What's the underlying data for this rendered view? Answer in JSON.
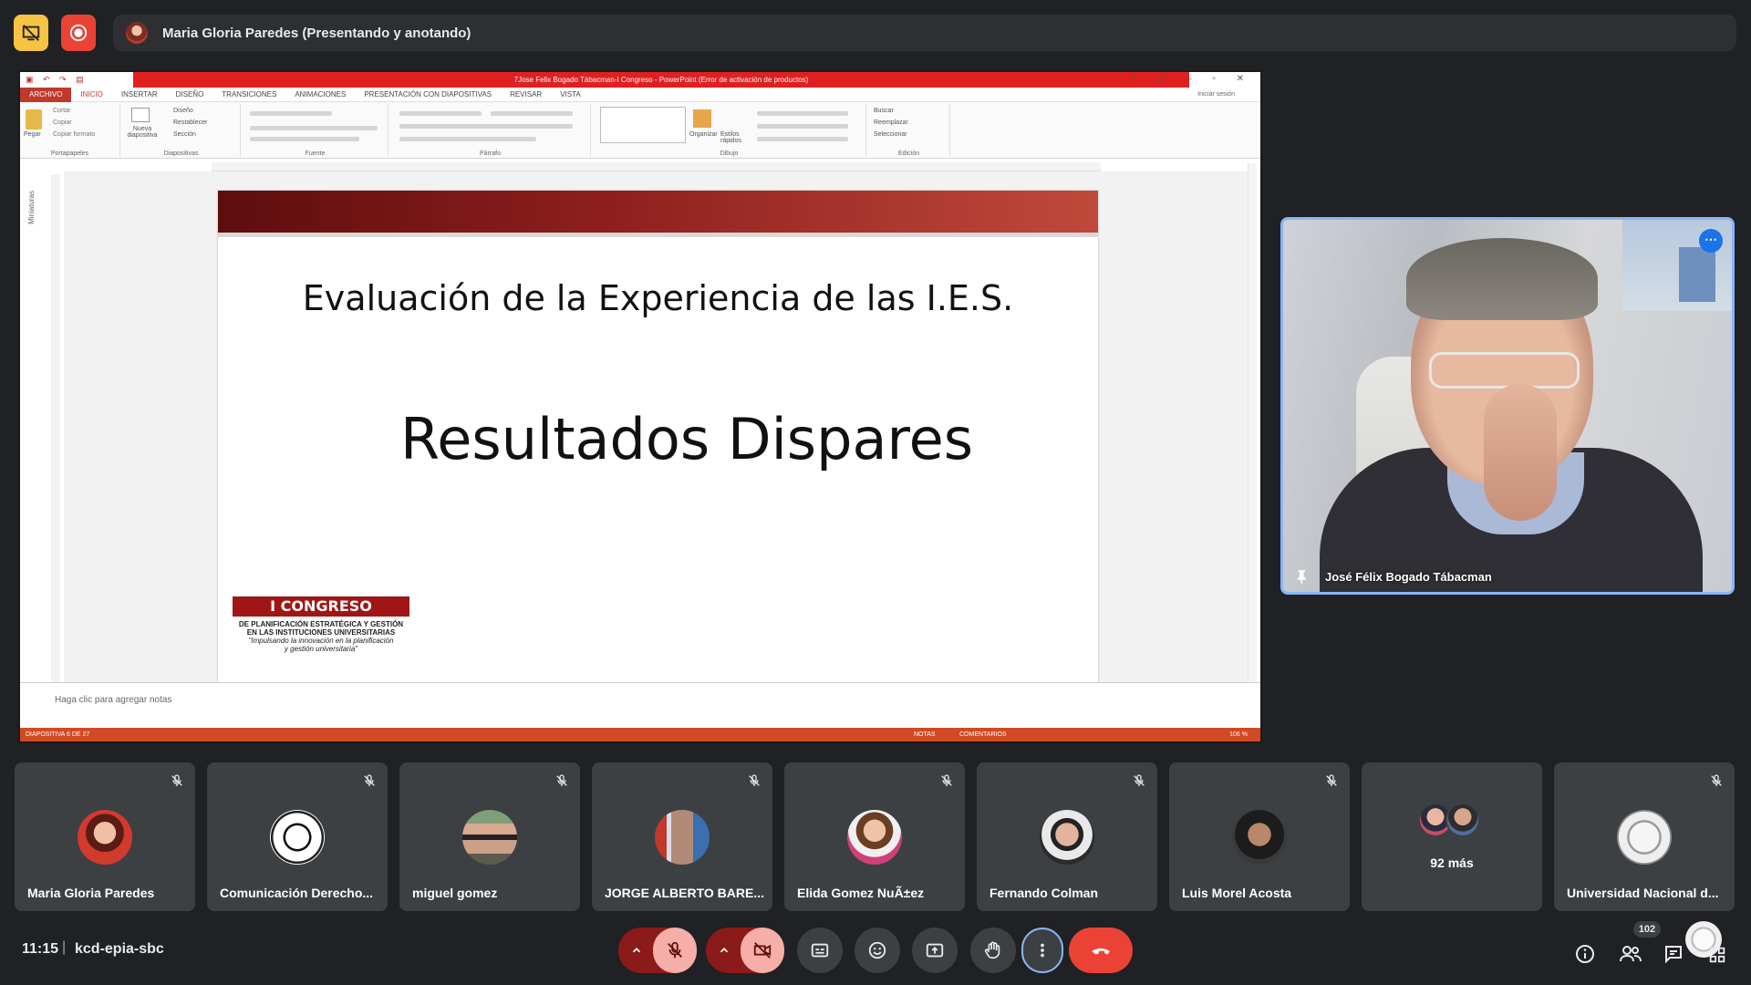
{
  "top_bar": {
    "presenter_label": "Maria Gloria Paredes (Presentando y anotando)"
  },
  "powerpoint": {
    "title": "7Jose Felix Bogado Tábacman-I Congreso - PowerPoint (Error de activación de productos)",
    "tabs": [
      "ARCHIVO",
      "INICIO",
      "INSERTAR",
      "DISEÑO",
      "TRANSICIONES",
      "ANIMACIONES",
      "PRESENTACIÓN CON DIAPOSITIVAS",
      "REVISAR",
      "VISTA"
    ],
    "active_tab": "INICIO",
    "sign_in": "Iniciar sesión",
    "ribbon_groups": [
      "Portapapeles",
      "Diapositivas",
      "Fuente",
      "Párrafo",
      "Dibujo",
      "Edición"
    ],
    "ribbon_items": {
      "paste": "Pegar",
      "cut": "Cortar",
      "copy": "Copiar",
      "format_painter": "Copiar formato",
      "new_slide": "Nueva diapositiva",
      "layout": "Diseño",
      "reset": "Restablecer",
      "section": "Sección",
      "arrange": "Organizar",
      "quick_styles": "Estilos rápidos",
      "find": "Buscar",
      "replace": "Reemplazar",
      "select": "Seleccionar"
    },
    "thumbnails_label": "Miniaturas",
    "notes_placeholder": "Haga clic para agregar notas",
    "status": {
      "slide": "DIAPOSITIVA 6 DE 27",
      "notes": "NOTAS",
      "comments": "COMENTARIOS",
      "zoom": "106 %"
    }
  },
  "slide": {
    "title": "Evaluación de la Experiencia de las I.E.S.",
    "main_text": "Resultados Dispares",
    "logo": {
      "banner": "I CONGRESO",
      "line1": "DE PLANIFICACIÓN ESTRATÉGICA Y GESTIÓN",
      "line2": "EN LAS INSTITUCIONES UNIVERSITARIAS",
      "line3": "\"Impulsando la innovación en la planificación",
      "line4": "y gestión universitaria\""
    }
  },
  "pinned": {
    "name": "José Félix Bogado Tábacman"
  },
  "participants": [
    {
      "name": "Maria Gloria Paredes",
      "avatar": "woman-red"
    },
    {
      "name": "Comunicación Derecho...",
      "avatar": "seal-bw"
    },
    {
      "name": "miguel gomez",
      "avatar": "man-sunglasses"
    },
    {
      "name": "JORGE ALBERTO BARE...",
      "avatar": "man-flags"
    },
    {
      "name": "Elida Gomez NuÃ±ez",
      "avatar": "woman-pink"
    },
    {
      "name": "Fernando Colman",
      "avatar": "man-glasses"
    },
    {
      "name": "Luis Morel Acosta",
      "avatar": "man-dark"
    }
  ],
  "more_tile": {
    "label": "92 más"
  },
  "last_tile": {
    "name": "Universidad Nacional d..."
  },
  "bottom_bar": {
    "time": "11:15",
    "separator": "|",
    "meeting_code": "kcd-epia-sbc",
    "participant_count": "102"
  },
  "colors": {
    "background": "#202124",
    "tile": "#3c4043",
    "hangup": "#ea4335",
    "mic_off_bg": "#f6aea9",
    "accent_blue": "#8ab4f8",
    "record_red": "#ea4335",
    "camera_alert_yellow": "#f6c344"
  }
}
